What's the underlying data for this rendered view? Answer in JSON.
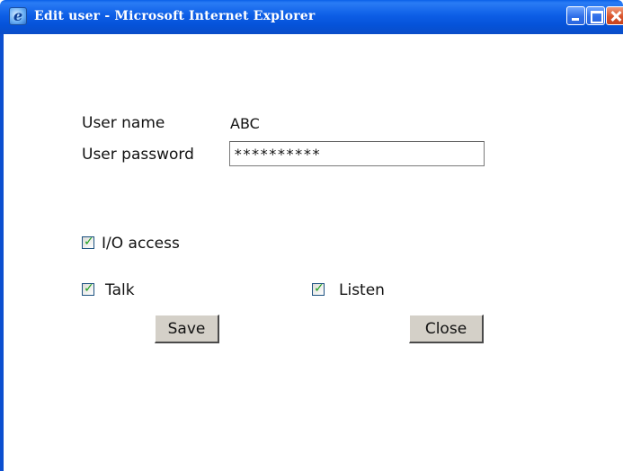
{
  "window": {
    "title": "Edit user - Microsoft Internet Explorer"
  },
  "form": {
    "username_label": "User name",
    "username_value": "ABC",
    "password_label": "User password",
    "password_value": "**********"
  },
  "permissions": {
    "io_access": {
      "label": "I/O access",
      "checked": true
    },
    "talk": {
      "label": "Talk",
      "checked": true
    },
    "listen": {
      "label": "Listen",
      "checked": true
    }
  },
  "buttons": {
    "save_label": "Save",
    "close_label": "Close"
  },
  "icons": {
    "checkmark": "✓"
  },
  "colors": {
    "titlebar": "#0552d8",
    "button_face": "#d4d0c8",
    "checkmark": "#21a121"
  }
}
